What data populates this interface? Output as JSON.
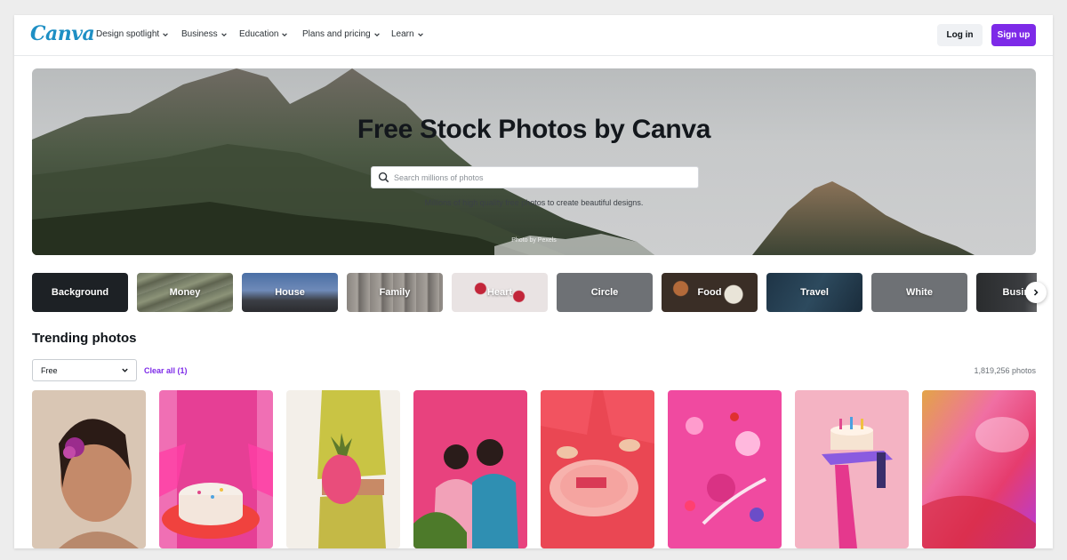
{
  "header": {
    "logo": "Canva",
    "nav": [
      {
        "label": "Design spotlight"
      },
      {
        "label": "Business"
      },
      {
        "label": "Education"
      },
      {
        "label": "Plans and pricing"
      },
      {
        "label": "Learn"
      }
    ],
    "login_label": "Log in",
    "signup_label": "Sign up"
  },
  "hero": {
    "title": "Free Stock Photos by Canva",
    "search_placeholder": "Search millions of photos",
    "subtitle": "Millions of high quality free photos to create beautiful designs.",
    "credit": "Photo by Pexels"
  },
  "categories": [
    {
      "label": "Background"
    },
    {
      "label": "Money"
    },
    {
      "label": "House"
    },
    {
      "label": "Family"
    },
    {
      "label": "Heart"
    },
    {
      "label": "Circle"
    },
    {
      "label": "Food"
    },
    {
      "label": "Travel"
    },
    {
      "label": "White"
    },
    {
      "label": "Business"
    }
  ],
  "trending": {
    "title": "Trending photos",
    "filter_value": "Free",
    "clear_label": "Clear all (1)",
    "count_label": "1,819,256 photos"
  },
  "colors": {
    "brand_purple": "#7d2ae8",
    "logo_blue": "#1e8fc4",
    "photo_theme": "#f2479a"
  },
  "icons": [
    "search-icon",
    "chevron-down-icon",
    "chevron-right-icon"
  ]
}
